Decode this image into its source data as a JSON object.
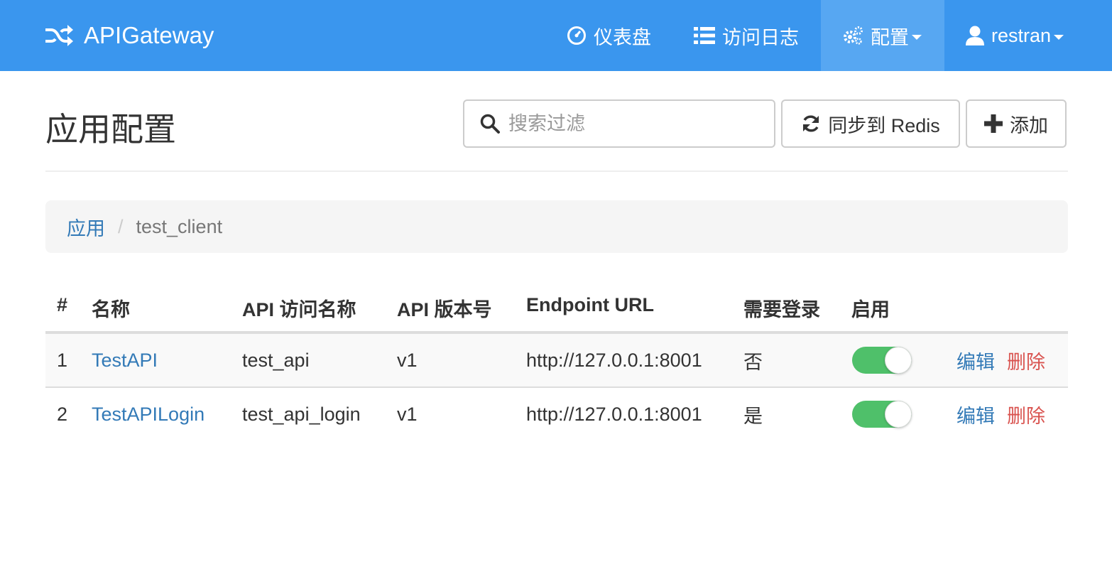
{
  "navbar": {
    "brand": "APIGateway",
    "items": [
      {
        "label": "仪表盘",
        "icon": "dashboard-icon"
      },
      {
        "label": "访问日志",
        "icon": "list-icon"
      },
      {
        "label": "配置",
        "icon": "cogs-icon",
        "active": true,
        "dropdown": true
      },
      {
        "label": "restran",
        "icon": "user-icon",
        "dropdown": true
      }
    ]
  },
  "header": {
    "title": "应用配置",
    "search_placeholder": "搜索过滤",
    "sync_label": "同步到 Redis",
    "add_label": "添加"
  },
  "breadcrumb": {
    "parent": "应用",
    "separator": "/",
    "current": "test_client"
  },
  "table": {
    "columns": [
      "#",
      "名称",
      "API 访问名称",
      "API 版本号",
      "Endpoint URL",
      "需要登录",
      "启用"
    ],
    "rows": [
      {
        "index": "1",
        "name": "TestAPI",
        "access_name": "test_api",
        "version": "v1",
        "endpoint": "http://127.0.0.1:8001",
        "login_required": "否",
        "enabled": true,
        "edit": "编辑",
        "delete": "删除"
      },
      {
        "index": "2",
        "name": "TestAPILogin",
        "access_name": "test_api_login",
        "version": "v1",
        "endpoint": "http://127.0.0.1:8001",
        "login_required": "是",
        "enabled": true,
        "edit": "编辑",
        "delete": "删除"
      }
    ]
  },
  "colors": {
    "navbar": "#3a96ee",
    "navbar_active": "#57a7f2",
    "link": "#337ab7",
    "danger": "#d9534f",
    "toggle_on": "#4fc06a"
  }
}
